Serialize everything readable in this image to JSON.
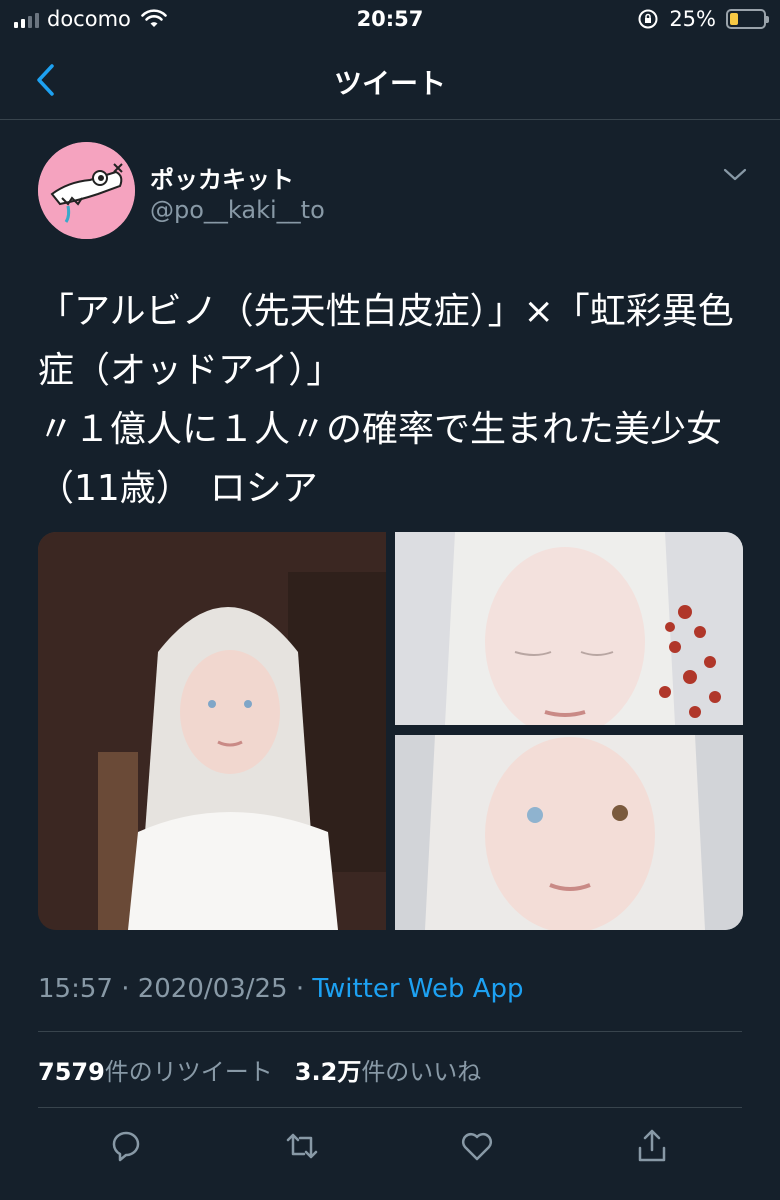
{
  "status_bar": {
    "carrier": "docomo",
    "time": "20:57",
    "battery_percent": "25%",
    "battery_level": 0.25
  },
  "nav": {
    "title": "ツイート"
  },
  "author": {
    "name": "ポッカキット",
    "handle": "@po__kaki__to"
  },
  "tweet": {
    "text": "「アルビノ（先天性白皮症）」×「虹彩異色症（オッドアイ）」\n〃１億人に１人〃の確率で生まれた美少女（11歳）　ロシア",
    "timestamp": "15:57 · 2020/03/25 · ",
    "source": "Twitter Web App"
  },
  "stats": {
    "retweets_count": "7579",
    "retweets_label": "件のリツイート",
    "likes_count": "3.2万",
    "likes_label": "件のいいね"
  },
  "icons": {
    "back": "chevron-left-icon",
    "menu": "chevron-down-icon",
    "reply": "reply-icon",
    "retweet": "retweet-icon",
    "like": "heart-icon",
    "share": "share-icon"
  },
  "colors": {
    "background": "#15202b",
    "accent": "#1da1f2",
    "secondary_text": "#8899a6",
    "divider": "#38444d"
  }
}
